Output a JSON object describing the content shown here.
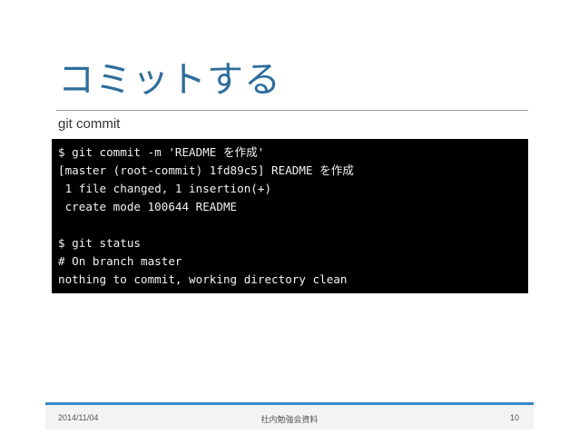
{
  "slide": {
    "title": "コミットする",
    "subtitle": "git commit"
  },
  "terminal": {
    "lines": [
      "$ git commit -m 'README を作成'",
      "[master (root-commit) 1fd89c5] README を作成",
      " 1 file changed, 1 insertion(+)",
      " create mode 100644 README",
      "",
      "$ git status",
      "# On branch master",
      "nothing to commit, working directory clean"
    ]
  },
  "footer": {
    "date": "2014/11/04",
    "center_text": "社内勉強会資料",
    "page_number": "10"
  },
  "colors": {
    "title": "#2d6e9b",
    "terminal_background": "#000000",
    "terminal_text": "#f2f2f2",
    "footer_accent": "#3b86c4",
    "footer_background": "#f3f3f3"
  }
}
